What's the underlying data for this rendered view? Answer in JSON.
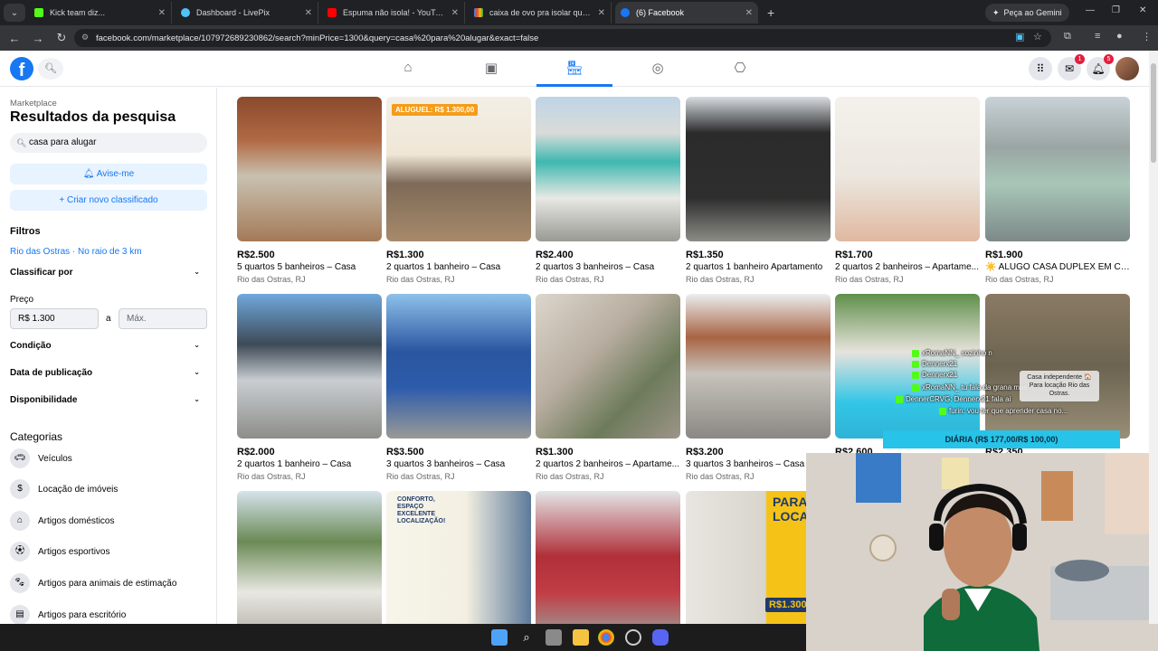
{
  "browser": {
    "tabs": [
      {
        "title": "Kick team diz..."
      },
      {
        "title": "Dashboard - LivePix"
      },
      {
        "title": "Espuma não isola! - YouTube"
      },
      {
        "title": "caixa de ovo pra isolar quarto -"
      },
      {
        "title": "(6) Facebook"
      }
    ],
    "gemini_label": "Peça ao Gemini",
    "url": "facebook.com/marketplace/107972689230862/search?minPrice=1300&query=casa%20para%20alugar&exact=false"
  },
  "header": {
    "messenger_badge": "1",
    "notifications_badge": "5"
  },
  "sidebar": {
    "crumb": "Marketplace",
    "title": "Resultados da pesquisa",
    "search_value": "casa para alugar",
    "alert_button": "Avise-me",
    "create_button": "Criar novo classificado",
    "filters_heading": "Filtros",
    "location": "Rio das Ostras · No raio de 3 km",
    "sort_label": "Classificar por",
    "price_heading": "Preço",
    "price_min": "R$ 1.300",
    "price_to": "a",
    "price_max_placeholder": "Máx.",
    "condition": "Condição",
    "publication_date": "Data de publicação",
    "availability": "Disponibilidade",
    "categories_heading": "Categorias",
    "categories": [
      {
        "label": "Veículos",
        "icon": "car-icon"
      },
      {
        "label": "Locação de imóveis",
        "icon": "house-price-icon"
      },
      {
        "label": "Artigos domésticos",
        "icon": "home-icon"
      },
      {
        "label": "Artigos esportivos",
        "icon": "sports-icon"
      },
      {
        "label": "Artigos para animais de estimação",
        "icon": "paw-icon"
      },
      {
        "label": "Artigos para escritório",
        "icon": "office-icon"
      }
    ]
  },
  "listings": [
    {
      "price": "R$2.500",
      "title": "5 quartos 5 banheiros – Casa",
      "location": "Rio das Ostras, RJ"
    },
    {
      "price": "R$1.300",
      "title": "2 quartos 1 banheiro – Casa",
      "location": "Rio das Ostras, RJ",
      "poster_tag": "ALUGUEL: R$ 1.300,00"
    },
    {
      "price": "R$2.400",
      "title": "2 quartos 3 banheiros – Casa",
      "location": "Rio das Ostras, RJ"
    },
    {
      "price": "R$1.350",
      "title": "2 quartos 1 banheiro Apartamento",
      "location": "Rio das Ostras, RJ"
    },
    {
      "price": "R$1.700",
      "title": "2 quartos 2 banheiros – Apartame...",
      "location": "Rio das Ostras, RJ"
    },
    {
      "price": "R$1.900",
      "title": "☀️ ALUGO CASA DÚPLEX EM CON...",
      "location": "Rio das Ostras, RJ"
    },
    {
      "price": "R$2.000",
      "title": "2 quartos 1 banheiro – Casa",
      "location": "Rio das Ostras, RJ"
    },
    {
      "price": "R$3.500",
      "title": "3 quartos 3 banheiros – Casa",
      "location": "Rio das Ostras, RJ"
    },
    {
      "price": "R$1.300",
      "title": "2 quartos 2 banheiros – Apartame...",
      "location": "Rio das Ostras, RJ"
    },
    {
      "price": "R$3.200",
      "title": "3 quartos 3 banheiros – Casa",
      "location": "Rio das Ostras, RJ"
    },
    {
      "price": "R$2.600",
      "title": "",
      "location": ""
    },
    {
      "price": "R$2.350",
      "title": "",
      "location": ""
    },
    {
      "price": "",
      "title": "",
      "location": ""
    },
    {
      "price": "",
      "title": "",
      "location": "",
      "poster_tag": "CONFORTO, ESPAÇO EXCELENTE LOCALIZAÇÃO!"
    },
    {
      "price": "",
      "title": "",
      "location": ""
    },
    {
      "price": "",
      "title": "",
      "location": "",
      "poster_tag": "PARA LOCAÇ",
      "poster_value": "R$1.300"
    }
  ],
  "overlay": {
    "chat": [
      {
        "text": "xRomaNN_ sozinho n"
      },
      {
        "text": "Dennerx21"
      },
      {
        "text": "Dennerx21"
      },
      {
        "text": "xRomaNN_ tu fala da grana mas..."
      },
      {
        "text": "DennerCRVG: Dennerx21 fala ai"
      },
      {
        "text": "furin: vou ter que aprender casa no..."
      }
    ],
    "popup_text": "Casa independente 🏠 Para locação Rio das Ostras.",
    "pix_bar": "DIÁRIA (R$ 177,00/R$ 100,00)"
  },
  "colors": {
    "facebook_blue": "#1877f2",
    "pix_bar": "#27c3e8",
    "kick_green": "#53fc18"
  }
}
